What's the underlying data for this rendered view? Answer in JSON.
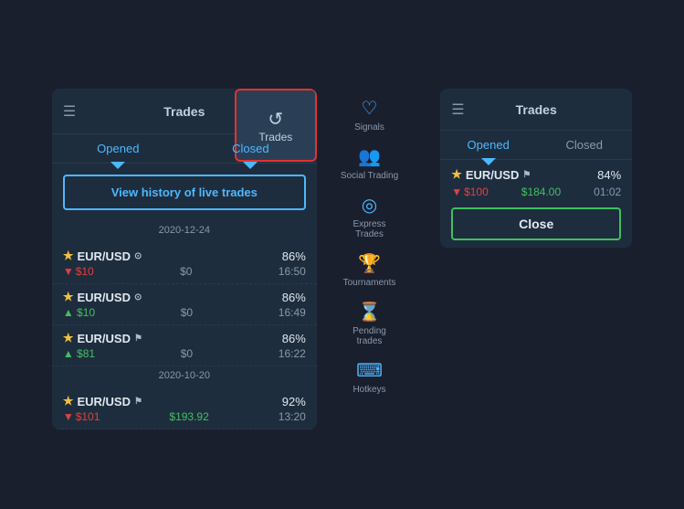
{
  "leftPanel": {
    "title": "Trades",
    "tabs": [
      {
        "label": "Opened",
        "active": false
      },
      {
        "label": "Closed",
        "active": true
      }
    ],
    "tradesBtn": {
      "icon": "↺",
      "label": "Trades"
    },
    "viewHistoryBtn": "View history of live trades",
    "dateSeparators": [
      "2020-12-24",
      "2020-10-20"
    ],
    "trades": [
      {
        "pair": "EUR/USD",
        "icon": "clock",
        "percent": "86%",
        "amount": "$10",
        "result": "$0",
        "time": "16:50",
        "direction": "down"
      },
      {
        "pair": "EUR/USD",
        "icon": "clock",
        "percent": "86%",
        "amount": "$10",
        "result": "$0",
        "time": "16:49",
        "direction": "up"
      },
      {
        "pair": "EUR/USD",
        "icon": "flag",
        "percent": "86%",
        "amount": "$81",
        "result": "$0",
        "time": "16:22",
        "direction": "up"
      },
      {
        "pair": "EUR/USD",
        "icon": "flag",
        "percent": "92%",
        "amount": "$101",
        "result": "$193.92",
        "time": "13:20",
        "direction": "down"
      }
    ]
  },
  "sidebar": {
    "items": [
      {
        "icon": "♡",
        "label": "Signals"
      },
      {
        "icon": "👥",
        "label": "Social Trading"
      },
      {
        "icon": "◎",
        "label": "Express\nTrades"
      },
      {
        "icon": "🏆",
        "label": "Tournaments"
      },
      {
        "icon": "⌛",
        "label": "Pending\ntrades"
      },
      {
        "icon": "⌨",
        "label": "Hotkeys"
      }
    ]
  },
  "rightPanel": {
    "title": "Trades",
    "tabs": [
      {
        "label": "Opened",
        "active": true
      },
      {
        "label": "Closed",
        "active": false
      }
    ],
    "trade": {
      "pair": "EUR/USD",
      "icon": "flag",
      "percent": "84%",
      "amount": "$100",
      "result": "$184.00",
      "time": "01:02"
    },
    "closeBtn": "Close"
  }
}
